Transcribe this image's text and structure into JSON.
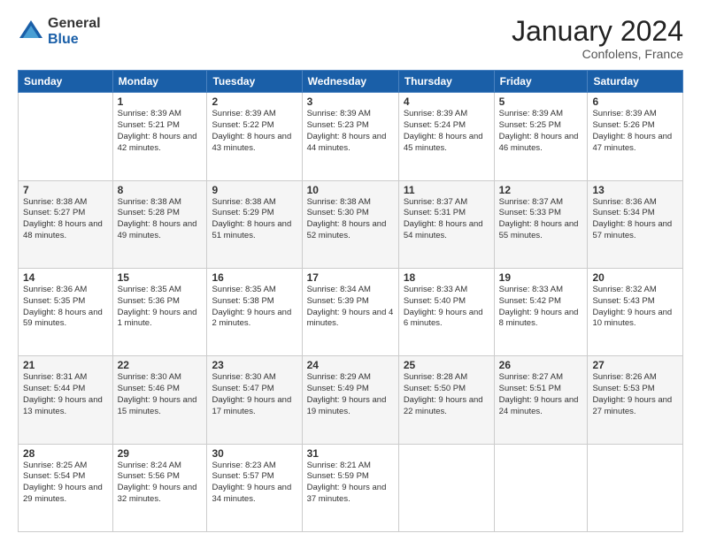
{
  "header": {
    "logo_general": "General",
    "logo_blue": "Blue",
    "month_title": "January 2024",
    "location": "Confolens, France"
  },
  "days_of_week": [
    "Sunday",
    "Monday",
    "Tuesday",
    "Wednesday",
    "Thursday",
    "Friday",
    "Saturday"
  ],
  "weeks": [
    {
      "days": [
        {
          "number": "",
          "sunrise": "",
          "sunset": "",
          "daylight": ""
        },
        {
          "number": "1",
          "sunrise": "Sunrise: 8:39 AM",
          "sunset": "Sunset: 5:21 PM",
          "daylight": "Daylight: 8 hours and 42 minutes."
        },
        {
          "number": "2",
          "sunrise": "Sunrise: 8:39 AM",
          "sunset": "Sunset: 5:22 PM",
          "daylight": "Daylight: 8 hours and 43 minutes."
        },
        {
          "number": "3",
          "sunrise": "Sunrise: 8:39 AM",
          "sunset": "Sunset: 5:23 PM",
          "daylight": "Daylight: 8 hours and 44 minutes."
        },
        {
          "number": "4",
          "sunrise": "Sunrise: 8:39 AM",
          "sunset": "Sunset: 5:24 PM",
          "daylight": "Daylight: 8 hours and 45 minutes."
        },
        {
          "number": "5",
          "sunrise": "Sunrise: 8:39 AM",
          "sunset": "Sunset: 5:25 PM",
          "daylight": "Daylight: 8 hours and 46 minutes."
        },
        {
          "number": "6",
          "sunrise": "Sunrise: 8:39 AM",
          "sunset": "Sunset: 5:26 PM",
          "daylight": "Daylight: 8 hours and 47 minutes."
        }
      ]
    },
    {
      "days": [
        {
          "number": "7",
          "sunrise": "Sunrise: 8:38 AM",
          "sunset": "Sunset: 5:27 PM",
          "daylight": "Daylight: 8 hours and 48 minutes."
        },
        {
          "number": "8",
          "sunrise": "Sunrise: 8:38 AM",
          "sunset": "Sunset: 5:28 PM",
          "daylight": "Daylight: 8 hours and 49 minutes."
        },
        {
          "number": "9",
          "sunrise": "Sunrise: 8:38 AM",
          "sunset": "Sunset: 5:29 PM",
          "daylight": "Daylight: 8 hours and 51 minutes."
        },
        {
          "number": "10",
          "sunrise": "Sunrise: 8:38 AM",
          "sunset": "Sunset: 5:30 PM",
          "daylight": "Daylight: 8 hours and 52 minutes."
        },
        {
          "number": "11",
          "sunrise": "Sunrise: 8:37 AM",
          "sunset": "Sunset: 5:31 PM",
          "daylight": "Daylight: 8 hours and 54 minutes."
        },
        {
          "number": "12",
          "sunrise": "Sunrise: 8:37 AM",
          "sunset": "Sunset: 5:33 PM",
          "daylight": "Daylight: 8 hours and 55 minutes."
        },
        {
          "number": "13",
          "sunrise": "Sunrise: 8:36 AM",
          "sunset": "Sunset: 5:34 PM",
          "daylight": "Daylight: 8 hours and 57 minutes."
        }
      ]
    },
    {
      "days": [
        {
          "number": "14",
          "sunrise": "Sunrise: 8:36 AM",
          "sunset": "Sunset: 5:35 PM",
          "daylight": "Daylight: 8 hours and 59 minutes."
        },
        {
          "number": "15",
          "sunrise": "Sunrise: 8:35 AM",
          "sunset": "Sunset: 5:36 PM",
          "daylight": "Daylight: 9 hours and 1 minute."
        },
        {
          "number": "16",
          "sunrise": "Sunrise: 8:35 AM",
          "sunset": "Sunset: 5:38 PM",
          "daylight": "Daylight: 9 hours and 2 minutes."
        },
        {
          "number": "17",
          "sunrise": "Sunrise: 8:34 AM",
          "sunset": "Sunset: 5:39 PM",
          "daylight": "Daylight: 9 hours and 4 minutes."
        },
        {
          "number": "18",
          "sunrise": "Sunrise: 8:33 AM",
          "sunset": "Sunset: 5:40 PM",
          "daylight": "Daylight: 9 hours and 6 minutes."
        },
        {
          "number": "19",
          "sunrise": "Sunrise: 8:33 AM",
          "sunset": "Sunset: 5:42 PM",
          "daylight": "Daylight: 9 hours and 8 minutes."
        },
        {
          "number": "20",
          "sunrise": "Sunrise: 8:32 AM",
          "sunset": "Sunset: 5:43 PM",
          "daylight": "Daylight: 9 hours and 10 minutes."
        }
      ]
    },
    {
      "days": [
        {
          "number": "21",
          "sunrise": "Sunrise: 8:31 AM",
          "sunset": "Sunset: 5:44 PM",
          "daylight": "Daylight: 9 hours and 13 minutes."
        },
        {
          "number": "22",
          "sunrise": "Sunrise: 8:30 AM",
          "sunset": "Sunset: 5:46 PM",
          "daylight": "Daylight: 9 hours and 15 minutes."
        },
        {
          "number": "23",
          "sunrise": "Sunrise: 8:30 AM",
          "sunset": "Sunset: 5:47 PM",
          "daylight": "Daylight: 9 hours and 17 minutes."
        },
        {
          "number": "24",
          "sunrise": "Sunrise: 8:29 AM",
          "sunset": "Sunset: 5:49 PM",
          "daylight": "Daylight: 9 hours and 19 minutes."
        },
        {
          "number": "25",
          "sunrise": "Sunrise: 8:28 AM",
          "sunset": "Sunset: 5:50 PM",
          "daylight": "Daylight: 9 hours and 22 minutes."
        },
        {
          "number": "26",
          "sunrise": "Sunrise: 8:27 AM",
          "sunset": "Sunset: 5:51 PM",
          "daylight": "Daylight: 9 hours and 24 minutes."
        },
        {
          "number": "27",
          "sunrise": "Sunrise: 8:26 AM",
          "sunset": "Sunset: 5:53 PM",
          "daylight": "Daylight: 9 hours and 27 minutes."
        }
      ]
    },
    {
      "days": [
        {
          "number": "28",
          "sunrise": "Sunrise: 8:25 AM",
          "sunset": "Sunset: 5:54 PM",
          "daylight": "Daylight: 9 hours and 29 minutes."
        },
        {
          "number": "29",
          "sunrise": "Sunrise: 8:24 AM",
          "sunset": "Sunset: 5:56 PM",
          "daylight": "Daylight: 9 hours and 32 minutes."
        },
        {
          "number": "30",
          "sunrise": "Sunrise: 8:23 AM",
          "sunset": "Sunset: 5:57 PM",
          "daylight": "Daylight: 9 hours and 34 minutes."
        },
        {
          "number": "31",
          "sunrise": "Sunrise: 8:21 AM",
          "sunset": "Sunset: 5:59 PM",
          "daylight": "Daylight: 9 hours and 37 minutes."
        },
        {
          "number": "",
          "sunrise": "",
          "sunset": "",
          "daylight": ""
        },
        {
          "number": "",
          "sunrise": "",
          "sunset": "",
          "daylight": ""
        },
        {
          "number": "",
          "sunrise": "",
          "sunset": "",
          "daylight": ""
        }
      ]
    }
  ]
}
